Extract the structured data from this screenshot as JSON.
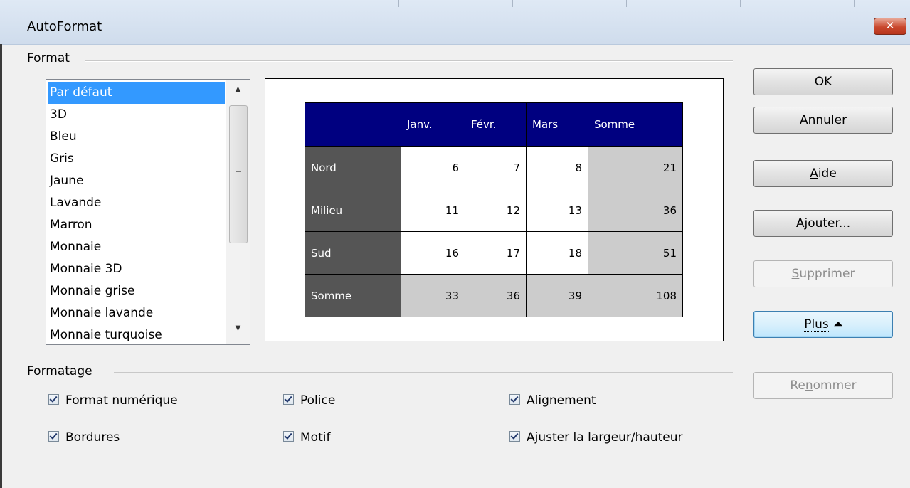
{
  "window": {
    "title": "AutoFormat",
    "close_icon": "close-icon"
  },
  "format_group": {
    "label_pre": "Forma",
    "label_mnemonic": "t"
  },
  "format_list": {
    "selected_index": 0,
    "items": [
      "Par défaut",
      "3D",
      "Bleu",
      "Gris",
      "Jaune",
      "Lavande",
      "Marron",
      "Monnaie",
      "Monnaie 3D",
      "Monnaie grise",
      "Monnaie lavande",
      "Monnaie turquoise"
    ]
  },
  "preview": {
    "header": [
      "",
      "Janv.",
      "Févr.",
      "Mars",
      "Somme"
    ],
    "rows": [
      [
        "Nord",
        "6",
        "7",
        "8",
        "21"
      ],
      [
        "Milieu",
        "11",
        "12",
        "13",
        "36"
      ],
      [
        "Sud",
        "16",
        "17",
        "18",
        "51"
      ],
      [
        "Somme",
        "33",
        "36",
        "39",
        "108"
      ]
    ],
    "colors": {
      "header_bg": "#000080",
      "row_header_bg": "#555555",
      "sum_bg": "#cccccc"
    }
  },
  "formatting_group": {
    "label": "Formatage"
  },
  "options": {
    "format_numerique": {
      "mnemonic": "F",
      "rest": "ormat numérique",
      "checked": true
    },
    "police": {
      "mnemonic": "P",
      "rest": "olice",
      "checked": true
    },
    "alignement": {
      "text": "Alignement",
      "checked": true
    },
    "bordures": {
      "mnemonic": "B",
      "rest": "ordures",
      "checked": true
    },
    "motif": {
      "mnemonic": "M",
      "rest": "otif",
      "checked": true
    },
    "ajuster": {
      "pre": "A",
      "mnemonic": "j",
      "rest": "uster la largeur/hauteur",
      "checked": true
    }
  },
  "buttons": {
    "ok": "OK",
    "annuler": "Annuler",
    "aide": {
      "mnemonic": "A",
      "rest": "ide"
    },
    "ajouter": {
      "pre": "A",
      "mnemonic": "j",
      "rest": "outer..."
    },
    "supprimer": {
      "mnemonic": "S",
      "rest": "upprimer"
    },
    "plus": {
      "text": "Plus",
      "arrow": "⏶"
    },
    "renommer": {
      "pre": "Re",
      "mnemonic": "n",
      "rest": "ommer"
    }
  }
}
